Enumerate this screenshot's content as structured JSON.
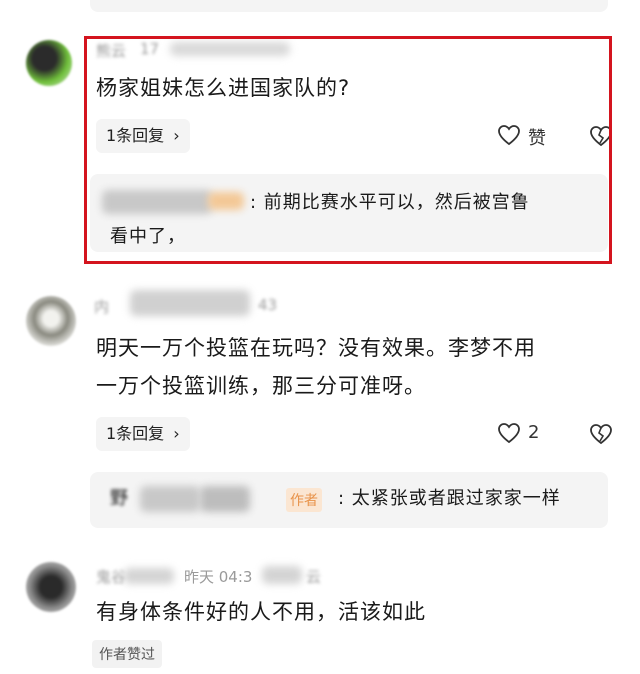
{
  "comments": [
    {
      "username": "熊云",
      "meta": "17",
      "text": "杨家姐妹怎么进国家队的?",
      "reply_count": "1条回复",
      "like_label": "赞",
      "reply_preview": {
        "text_line1": ": 前期比赛水平可以，然后被宫鲁",
        "text_line2": "看中了，"
      }
    },
    {
      "username": "内",
      "meta": "43",
      "text_line1": "明天一万个投篮在玩吗？没有效果。李梦不用",
      "text_line2": "一万个投篮训练，那三分可准呀。",
      "reply_count": "1条回复",
      "like_count": "2",
      "reply_preview": {
        "author": "野",
        "author_tag": "作者",
        "text": ": 太紧张或者跟过家家一样"
      }
    },
    {
      "username": "鬼谷",
      "time": "昨天 04:3",
      "meta": "云",
      "text": "有身体条件好的人不用，活该如此",
      "author_liked": "作者赞过"
    }
  ],
  "icons": [
    "heart-icon",
    "broken-heart-icon",
    "chevron-right-icon"
  ],
  "colors": {
    "highlight": "#d4141e",
    "reply_bg": "#f4f4f4",
    "meta_gray": "#9a9a9a",
    "author_tag": "#e8934a"
  }
}
